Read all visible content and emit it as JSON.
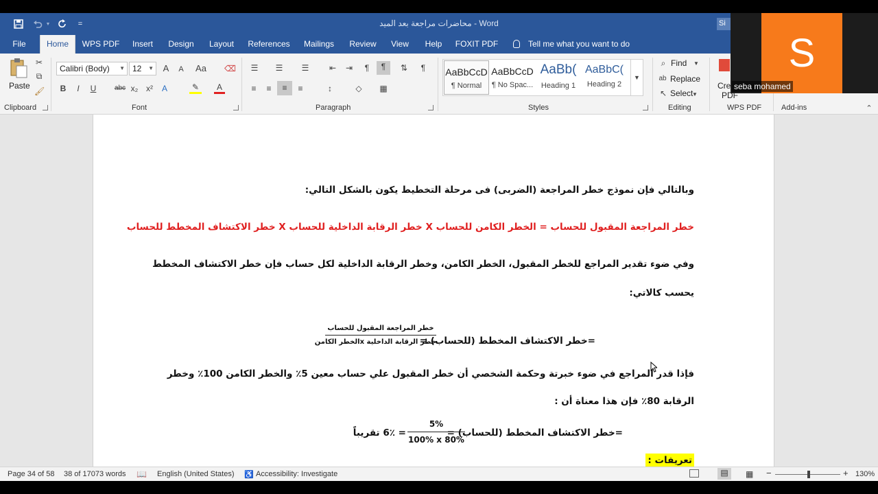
{
  "titlebar": {
    "doc_title": "محاضرات مراجعة بعد الميد",
    "separator": "-",
    "app_name": "Word",
    "signin": "Si",
    "qat_customize": "="
  },
  "tabs": [
    {
      "label": "File"
    },
    {
      "label": "Home"
    },
    {
      "label": "WPS PDF"
    },
    {
      "label": "Insert"
    },
    {
      "label": "Design"
    },
    {
      "label": "Layout"
    },
    {
      "label": "References"
    },
    {
      "label": "Mailings"
    },
    {
      "label": "Review"
    },
    {
      "label": "View"
    },
    {
      "label": "Help"
    },
    {
      "label": "FOXIT PDF"
    }
  ],
  "tell_me": "Tell me what you want to do",
  "ribbon": {
    "clipboard": {
      "paste": "Paste",
      "label": "Clipboard"
    },
    "font": {
      "name": "Calibri (Body)",
      "size": "12",
      "grow": "A",
      "shrink": "A",
      "case": "Aa",
      "bold": "B",
      "italic": "I",
      "underline": "U",
      "strike": "abc",
      "sub": "x₂",
      "sup": "x²",
      "label": "Font"
    },
    "paragraph": {
      "label": "Paragraph"
    },
    "styles": {
      "items": [
        {
          "preview": "AaBbCcD",
          "name": "¶ Normal"
        },
        {
          "preview": "AaBbCcD",
          "name": "¶ No Spac..."
        },
        {
          "preview": "AaBb(",
          "name": "Heading 1"
        },
        {
          "preview": "AaBbC(",
          "name": "Heading 2"
        }
      ],
      "label": "Styles"
    },
    "editing": {
      "find": "Find",
      "replace": "Replace",
      "select": "Select",
      "label": "Editing"
    },
    "wps": {
      "create": "Cre",
      "pdf": "PDF",
      "label": "WPS PDF"
    },
    "addins": {
      "label": "Add-ins"
    }
  },
  "webcam": {
    "initial": "S",
    "name": "seba mohamed"
  },
  "document": {
    "line1": "وبالتالي فإن نموذج خطر المراجعة (الضربى) فى مرحلة التخطيط يكون بالشكل التالي:",
    "line2": "خطر المراجعة المقبول للحساب = الخطر الكامن للحساب X خطر الرقابة الداخلية للحساب X خطر الاكتشاف المخطط للحساب",
    "line3": "وفي ضوء تقدير المراجع للخطر المقبول، الخطر الكامن، وخطر الرقابة الداخلية لكل  حساب فإن خطر الاكتشاف المخطط",
    "line4": "يحسب كالاتي:",
    "formula1": {
      "lhs": "=خطر الاكتشاف المخطط (للحساب) =",
      "numerator": "خطر المراجعة المقبول للحساب",
      "denominator": "خطر الرقابة الداخلية xالخطر الكامن"
    },
    "line5": "فإذا قدر المراجع في ضوء خبرتة وحكمة الشخصي  أن خطر المقبول علي حساب معين 5٪ والخطر الكامن 100٪ وخطر",
    "line6": "الرقابة 80٪ فإن هذا معناة أن :",
    "formula2": {
      "lhs": "=خطر الاكتشاف المخطط (للحساب) =",
      "numerator": "5%",
      "denominator": "100% x 80%",
      "rhs": "= 6٪ تقريباً"
    },
    "line7": "تعريفات :"
  },
  "status": {
    "page": "Page 34 of 58",
    "words": "38 of 17073 words",
    "language": "English (United States)",
    "accessibility": "Accessibility: Investigate",
    "zoom_minus": "−",
    "zoom_plus": "+",
    "zoom": "130%"
  },
  "colors": {
    "brand": "#2b579a",
    "red_text": "#e02020",
    "highlight": "#ffff00",
    "webcam": "#f77a1b"
  }
}
